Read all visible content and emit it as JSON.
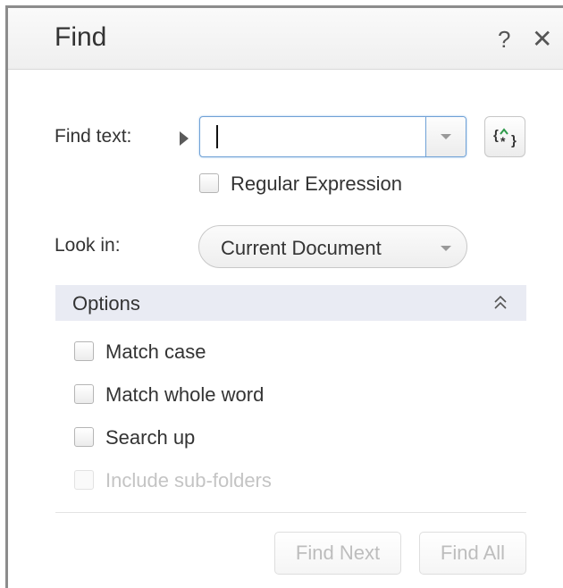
{
  "dialog": {
    "title": "Find",
    "help_label": "?",
    "close_label": "✕"
  },
  "find": {
    "label": "Find text:",
    "value": "",
    "regex_checkbox_label": "Regular Expression",
    "regex_checked": false
  },
  "look_in": {
    "label": "Look in:",
    "selected": "Current Document"
  },
  "options": {
    "header": "Options",
    "expanded": true,
    "items": [
      {
        "label": "Match case",
        "checked": false,
        "disabled": false
      },
      {
        "label": "Match whole word",
        "checked": false,
        "disabled": false
      },
      {
        "label": "Search up",
        "checked": false,
        "disabled": false
      },
      {
        "label": "Include sub-folders",
        "checked": false,
        "disabled": true
      }
    ]
  },
  "buttons": {
    "find_next": "Find Next",
    "find_all": "Find All"
  },
  "icons": {
    "expand_arrow": "right-triangle-icon",
    "regex_builder": "regex-builder-icon",
    "dropdown": "chevron-down-icon",
    "collapse": "double-chevron-up-icon"
  },
  "colors": {
    "focus_border": "#6fa1d6",
    "options_header_bg": "#e9ebf3",
    "disabled_text": "#c4c4c4",
    "regex_icon_accent": "#2e9a4a"
  }
}
